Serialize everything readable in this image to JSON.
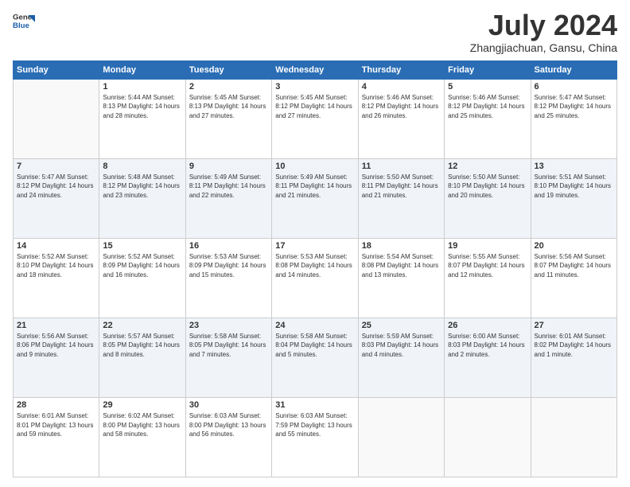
{
  "logo": {
    "line1": "General",
    "line2": "Blue"
  },
  "title": "July 2024",
  "subtitle": "Zhangjiachuan, Gansu, China",
  "headers": [
    "Sunday",
    "Monday",
    "Tuesday",
    "Wednesday",
    "Thursday",
    "Friday",
    "Saturday"
  ],
  "weeks": [
    [
      {
        "day": "",
        "info": ""
      },
      {
        "day": "1",
        "info": "Sunrise: 5:44 AM\nSunset: 8:13 PM\nDaylight: 14 hours\nand 28 minutes."
      },
      {
        "day": "2",
        "info": "Sunrise: 5:45 AM\nSunset: 8:13 PM\nDaylight: 14 hours\nand 27 minutes."
      },
      {
        "day": "3",
        "info": "Sunrise: 5:45 AM\nSunset: 8:12 PM\nDaylight: 14 hours\nand 27 minutes."
      },
      {
        "day": "4",
        "info": "Sunrise: 5:46 AM\nSunset: 8:12 PM\nDaylight: 14 hours\nand 26 minutes."
      },
      {
        "day": "5",
        "info": "Sunrise: 5:46 AM\nSunset: 8:12 PM\nDaylight: 14 hours\nand 25 minutes."
      },
      {
        "day": "6",
        "info": "Sunrise: 5:47 AM\nSunset: 8:12 PM\nDaylight: 14 hours\nand 25 minutes."
      }
    ],
    [
      {
        "day": "7",
        "info": "Sunrise: 5:47 AM\nSunset: 8:12 PM\nDaylight: 14 hours\nand 24 minutes."
      },
      {
        "day": "8",
        "info": "Sunrise: 5:48 AM\nSunset: 8:12 PM\nDaylight: 14 hours\nand 23 minutes."
      },
      {
        "day": "9",
        "info": "Sunrise: 5:49 AM\nSunset: 8:11 PM\nDaylight: 14 hours\nand 22 minutes."
      },
      {
        "day": "10",
        "info": "Sunrise: 5:49 AM\nSunset: 8:11 PM\nDaylight: 14 hours\nand 21 minutes."
      },
      {
        "day": "11",
        "info": "Sunrise: 5:50 AM\nSunset: 8:11 PM\nDaylight: 14 hours\nand 21 minutes."
      },
      {
        "day": "12",
        "info": "Sunrise: 5:50 AM\nSunset: 8:10 PM\nDaylight: 14 hours\nand 20 minutes."
      },
      {
        "day": "13",
        "info": "Sunrise: 5:51 AM\nSunset: 8:10 PM\nDaylight: 14 hours\nand 19 minutes."
      }
    ],
    [
      {
        "day": "14",
        "info": "Sunrise: 5:52 AM\nSunset: 8:10 PM\nDaylight: 14 hours\nand 18 minutes."
      },
      {
        "day": "15",
        "info": "Sunrise: 5:52 AM\nSunset: 8:09 PM\nDaylight: 14 hours\nand 16 minutes."
      },
      {
        "day": "16",
        "info": "Sunrise: 5:53 AM\nSunset: 8:09 PM\nDaylight: 14 hours\nand 15 minutes."
      },
      {
        "day": "17",
        "info": "Sunrise: 5:53 AM\nSunset: 8:08 PM\nDaylight: 14 hours\nand 14 minutes."
      },
      {
        "day": "18",
        "info": "Sunrise: 5:54 AM\nSunset: 8:08 PM\nDaylight: 14 hours\nand 13 minutes."
      },
      {
        "day": "19",
        "info": "Sunrise: 5:55 AM\nSunset: 8:07 PM\nDaylight: 14 hours\nand 12 minutes."
      },
      {
        "day": "20",
        "info": "Sunrise: 5:56 AM\nSunset: 8:07 PM\nDaylight: 14 hours\nand 11 minutes."
      }
    ],
    [
      {
        "day": "21",
        "info": "Sunrise: 5:56 AM\nSunset: 8:06 PM\nDaylight: 14 hours\nand 9 minutes."
      },
      {
        "day": "22",
        "info": "Sunrise: 5:57 AM\nSunset: 8:05 PM\nDaylight: 14 hours\nand 8 minutes."
      },
      {
        "day": "23",
        "info": "Sunrise: 5:58 AM\nSunset: 8:05 PM\nDaylight: 14 hours\nand 7 minutes."
      },
      {
        "day": "24",
        "info": "Sunrise: 5:58 AM\nSunset: 8:04 PM\nDaylight: 14 hours\nand 5 minutes."
      },
      {
        "day": "25",
        "info": "Sunrise: 5:59 AM\nSunset: 8:03 PM\nDaylight: 14 hours\nand 4 minutes."
      },
      {
        "day": "26",
        "info": "Sunrise: 6:00 AM\nSunset: 8:03 PM\nDaylight: 14 hours\nand 2 minutes."
      },
      {
        "day": "27",
        "info": "Sunrise: 6:01 AM\nSunset: 8:02 PM\nDaylight: 14 hours\nand 1 minute."
      }
    ],
    [
      {
        "day": "28",
        "info": "Sunrise: 6:01 AM\nSunset: 8:01 PM\nDaylight: 13 hours\nand 59 minutes."
      },
      {
        "day": "29",
        "info": "Sunrise: 6:02 AM\nSunset: 8:00 PM\nDaylight: 13 hours\nand 58 minutes."
      },
      {
        "day": "30",
        "info": "Sunrise: 6:03 AM\nSunset: 8:00 PM\nDaylight: 13 hours\nand 56 minutes."
      },
      {
        "day": "31",
        "info": "Sunrise: 6:03 AM\nSunset: 7:59 PM\nDaylight: 13 hours\nand 55 minutes."
      },
      {
        "day": "",
        "info": ""
      },
      {
        "day": "",
        "info": ""
      },
      {
        "day": "",
        "info": ""
      }
    ]
  ]
}
